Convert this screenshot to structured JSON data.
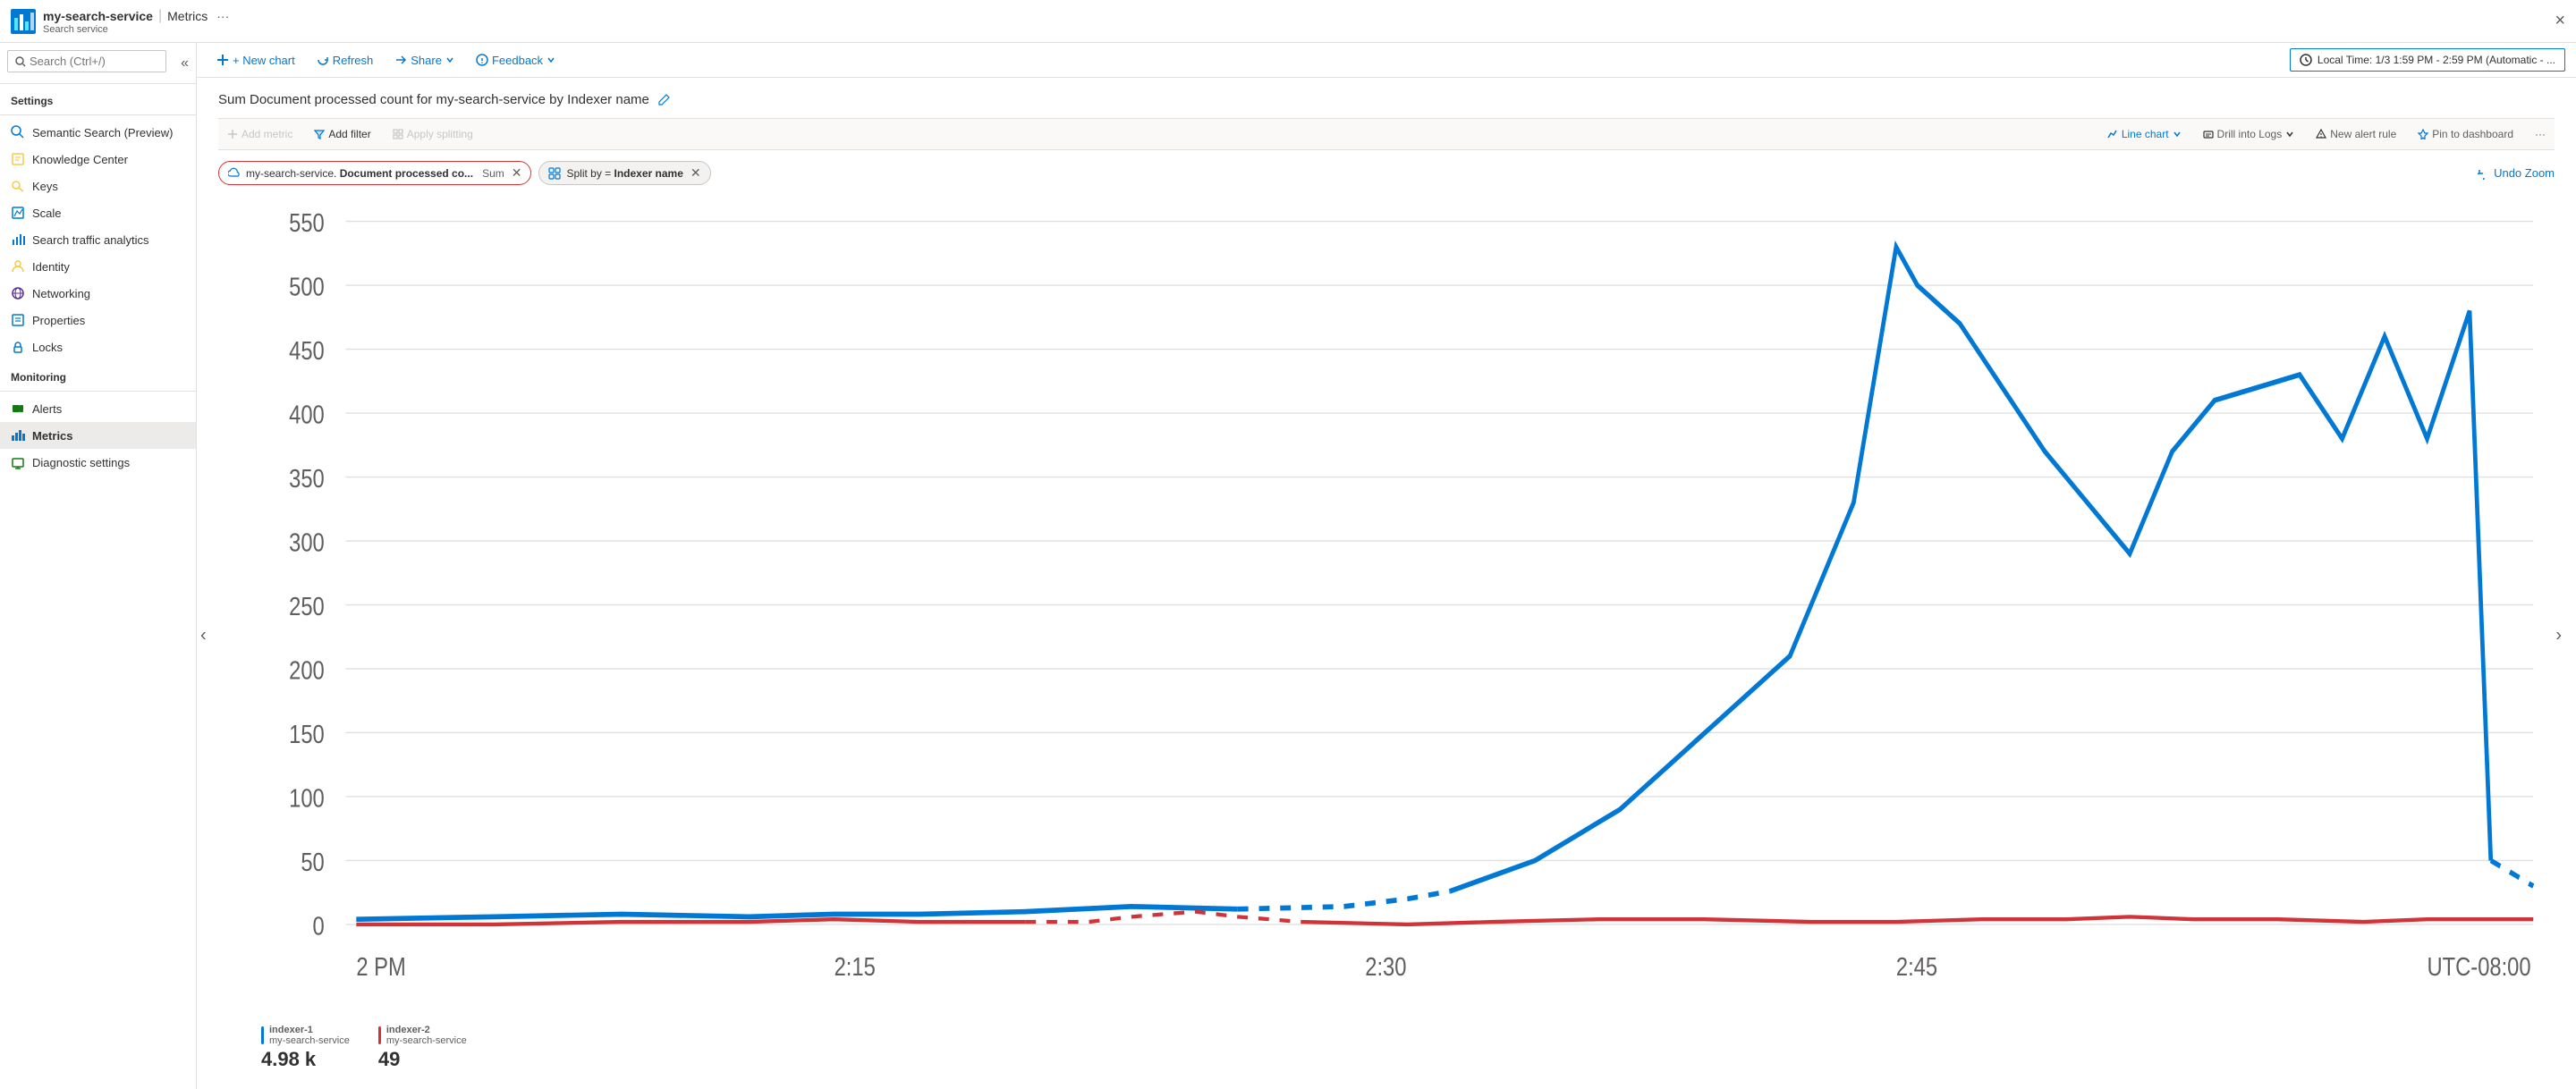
{
  "topbar": {
    "service_name": "my-search-service",
    "separator": "|",
    "page_title": "Metrics",
    "ellipsis": "···",
    "subtitle": "Search service",
    "close_label": "×"
  },
  "toolbar": {
    "new_chart_label": "+ New chart",
    "refresh_label": "Refresh",
    "share_label": "Share",
    "feedback_label": "Feedback",
    "time_range_label": "Local Time: 1/3 1:59 PM - 2:59 PM (Automatic - ..."
  },
  "sidebar": {
    "search_placeholder": "Search (Ctrl+/)",
    "settings_label": "Settings",
    "monitoring_label": "Monitoring",
    "items_settings": [
      {
        "id": "semantic-search",
        "label": "Semantic Search (Preview)",
        "icon": "search"
      },
      {
        "id": "knowledge-center",
        "label": "Knowledge Center",
        "icon": "book"
      },
      {
        "id": "keys",
        "label": "Keys",
        "icon": "key"
      },
      {
        "id": "scale",
        "label": "Scale",
        "icon": "scale"
      },
      {
        "id": "search-traffic",
        "label": "Search traffic analytics",
        "icon": "chart-bar"
      },
      {
        "id": "identity",
        "label": "Identity",
        "icon": "identity"
      },
      {
        "id": "networking",
        "label": "Networking",
        "icon": "network"
      },
      {
        "id": "properties",
        "label": "Properties",
        "icon": "properties"
      },
      {
        "id": "locks",
        "label": "Locks",
        "icon": "lock"
      }
    ],
    "items_monitoring": [
      {
        "id": "alerts",
        "label": "Alerts",
        "icon": "alert"
      },
      {
        "id": "metrics",
        "label": "Metrics",
        "icon": "metrics",
        "active": true
      },
      {
        "id": "diagnostic",
        "label": "Diagnostic settings",
        "icon": "diagnostic"
      }
    ]
  },
  "chart": {
    "title": "Sum Document processed count for my-search-service by Indexer name",
    "add_metric_label": "Add metric",
    "add_filter_label": "Add filter",
    "apply_splitting_label": "Apply splitting",
    "line_chart_label": "Line chart",
    "drill_logs_label": "Drill into Logs",
    "new_alert_label": "New alert rule",
    "pin_dashboard_label": "Pin to dashboard",
    "more_label": "···",
    "undo_zoom_label": "Undo Zoom",
    "pill1_icon": "cloud",
    "pill1_text": "my-search-service. Document processed co...",
    "pill1_agg": "Sum",
    "pill2_text": "Split by = Indexer name",
    "y_axis": [
      "550",
      "500",
      "450",
      "400",
      "350",
      "300",
      "250",
      "200",
      "150",
      "100",
      "50",
      "0"
    ],
    "x_axis": [
      "2 PM",
      "2:15",
      "2:30",
      "2:45",
      "UTC-08:00"
    ],
    "legend": [
      {
        "id": "indexer-1",
        "label": "indexer-1",
        "sublabel": "my-search-service",
        "value": "4.98 k",
        "color": "#0078d4"
      },
      {
        "id": "indexer-2",
        "label": "indexer-2",
        "sublabel": "my-search-service",
        "value": "49",
        "color": "#d13438"
      }
    ]
  }
}
